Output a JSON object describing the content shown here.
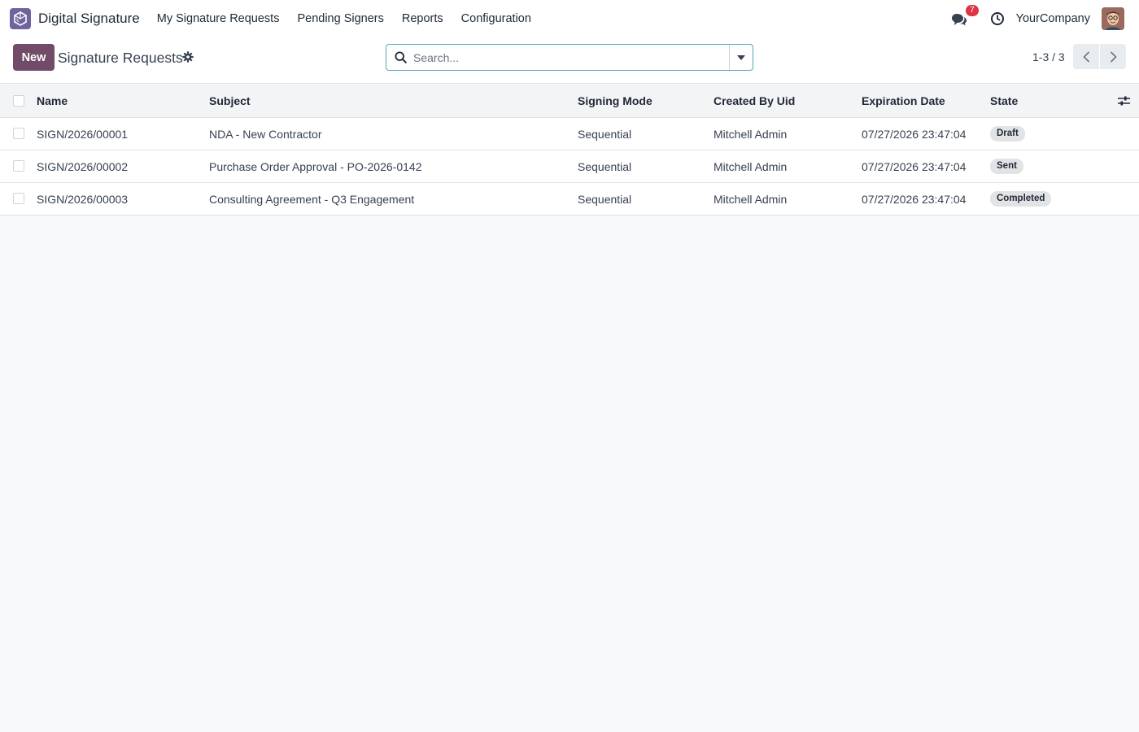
{
  "navbar": {
    "app_name": "Digital Signature",
    "menu": [
      {
        "label": "My Signature Requests"
      },
      {
        "label": "Pending Signers"
      },
      {
        "label": "Reports"
      },
      {
        "label": "Configuration"
      }
    ],
    "messages_badge": "7",
    "company": "YourCompany"
  },
  "control": {
    "new_label": "New",
    "title": "Signature Requests",
    "search_placeholder": "Search...",
    "pager": "1-3 / 3"
  },
  "table": {
    "columns": [
      "Name",
      "Subject",
      "Signing Mode",
      "Created By Uid",
      "Expiration Date",
      "State"
    ],
    "rows": [
      {
        "name": "SIGN/2026/00001",
        "subject": "NDA - New Contractor",
        "signing_mode": "Sequential",
        "created_by": "Mitchell Admin",
        "expiration": "07/27/2026 23:47:04",
        "state": "Draft"
      },
      {
        "name": "SIGN/2026/00002",
        "subject": "Purchase Order Approval - PO-2026-0142",
        "signing_mode": "Sequential",
        "created_by": "Mitchell Admin",
        "expiration": "07/27/2026 23:47:04",
        "state": "Sent"
      },
      {
        "name": "SIGN/2026/00003",
        "subject": "Consulting Agreement - Q3 Engagement",
        "signing_mode": "Sequential",
        "created_by": "Mitchell Admin",
        "expiration": "07/27/2026 23:47:04",
        "state": "Completed"
      }
    ]
  },
  "colors": {
    "brand": "#714b67",
    "app_icon": "#71639e",
    "search_border": "#5aa6b7",
    "badge": "#dc3545"
  },
  "icons": [
    "app-logo-icon",
    "chat-icon",
    "clock-icon",
    "gear-icon",
    "search-icon",
    "caret-down-icon",
    "chevron-left-icon",
    "chevron-right-icon",
    "column-settings-icon"
  ]
}
